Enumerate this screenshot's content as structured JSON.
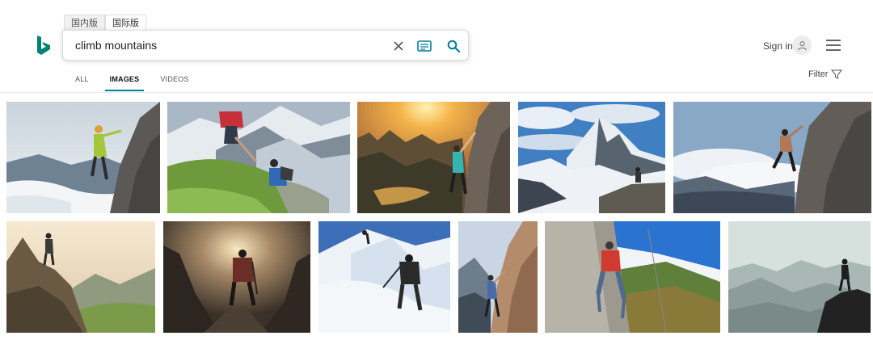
{
  "region_tabs": [
    "国内版",
    "国际版"
  ],
  "search": {
    "value": "climb mountains"
  },
  "header": {
    "signin_label": "Sign in"
  },
  "nav": {
    "tabs": [
      "ALL",
      "IMAGES",
      "VIDEOS"
    ],
    "active": "IMAGES"
  },
  "filter": {
    "label": "Filter"
  },
  "colors": {
    "accent": "#00809d",
    "brand": "#008373"
  },
  "icons": [
    "bing-logo-icon",
    "clear-icon",
    "visual-search-icon",
    "search-icon",
    "user-icon",
    "hamburger-menu-icon",
    "filter-funnel-icon"
  ],
  "results": [
    {
      "id": "r1"
    },
    {
      "id": "r2"
    },
    {
      "id": "r3"
    },
    {
      "id": "r4"
    },
    {
      "id": "r5"
    },
    {
      "id": "r6"
    },
    {
      "id": "r7"
    },
    {
      "id": "r8"
    },
    {
      "id": "r9"
    },
    {
      "id": "r10"
    },
    {
      "id": "r11"
    }
  ]
}
